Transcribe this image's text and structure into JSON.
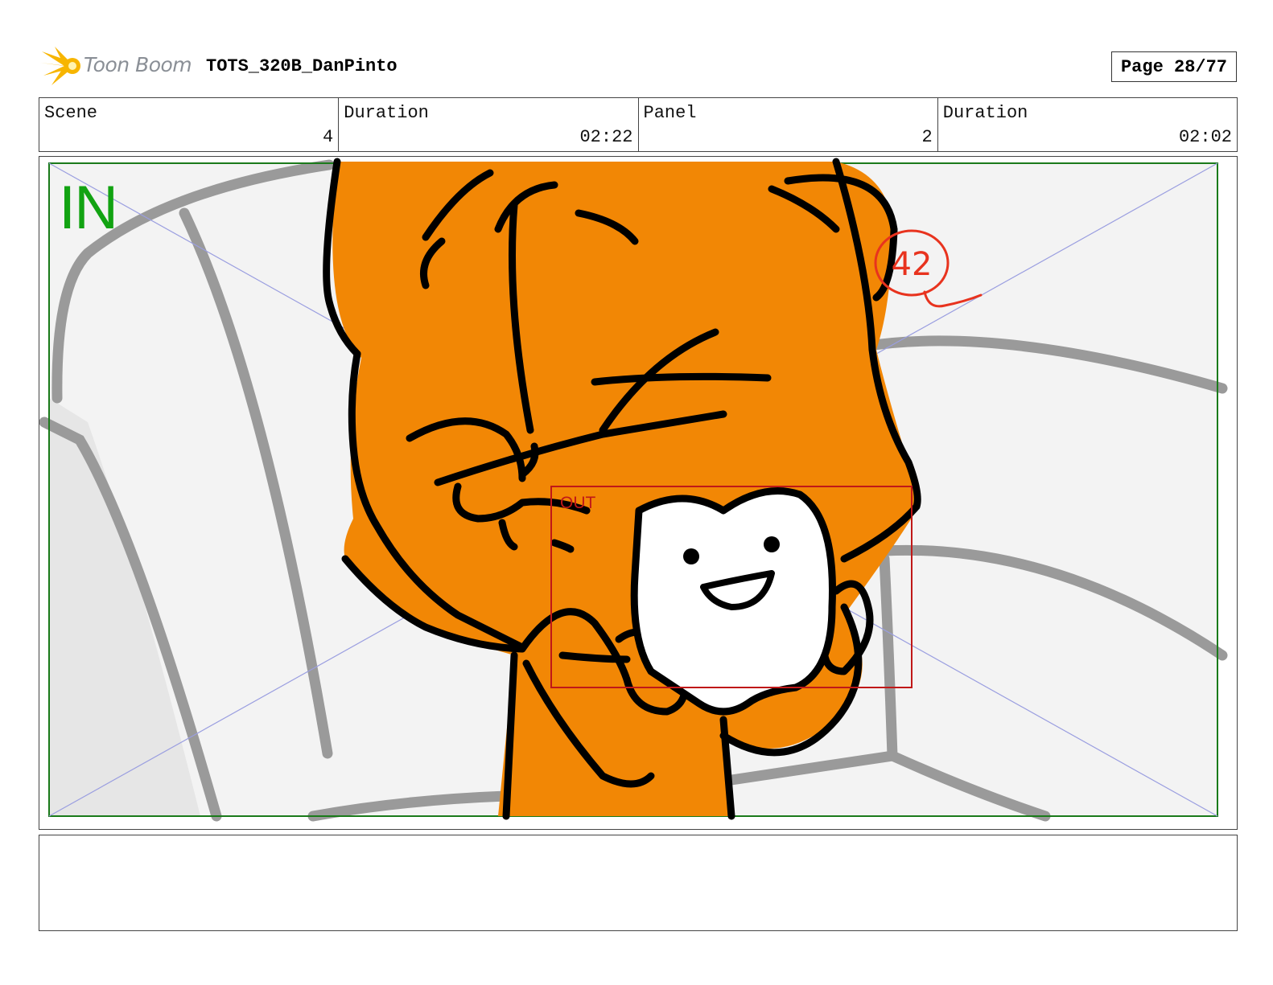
{
  "header": {
    "logo_text": "Toon Boom",
    "project_title": "TOTS_320B_DanPinto",
    "page_label": "Page 28/77"
  },
  "info": [
    {
      "label": "Scene",
      "value": "4"
    },
    {
      "label": "Duration",
      "value": "02:22"
    },
    {
      "label": "Panel",
      "value": "2"
    },
    {
      "label": "Duration",
      "value": "02:02"
    }
  ],
  "panel": {
    "in_label": "IN",
    "out_label": "OUT",
    "annotation": "42"
  },
  "notes": {
    "text": ""
  },
  "colors": {
    "character_orange": "#f28705",
    "in_frame": "#1a7a1a",
    "out_frame": "#c01818",
    "annotation_red": "#e8331e",
    "couch_gray": "#9a9a9a",
    "diagonal_blue": "#9a9ee0"
  }
}
